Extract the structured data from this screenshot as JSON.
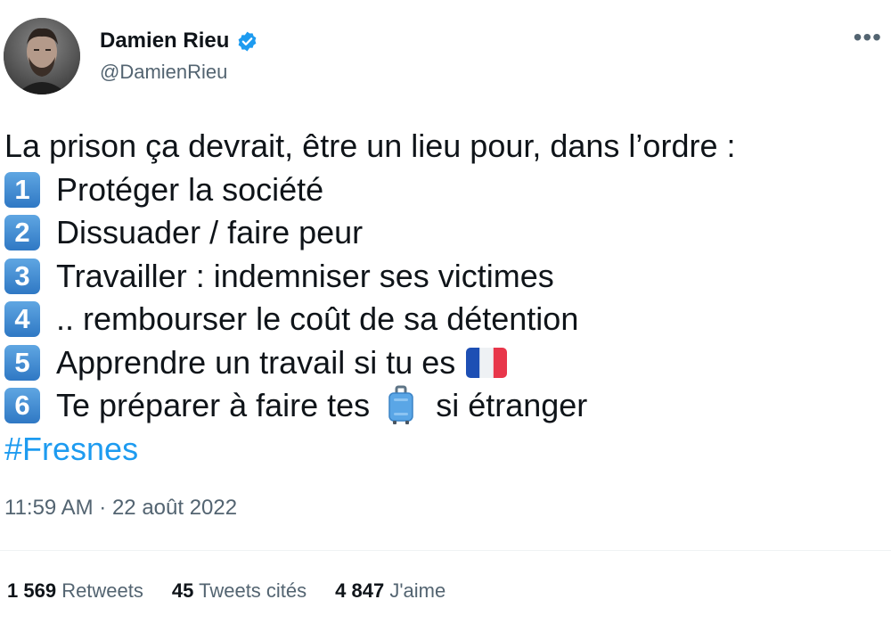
{
  "author": {
    "display_name": "Damien Rieu",
    "handle": "@DamienRieu",
    "verified": true,
    "verified_color": "#1d9bf0"
  },
  "menu_icon": "more-options-icon",
  "tweet": {
    "intro": "La prison ça devrait, être un lieu pour, dans l’ordre :",
    "items": [
      {
        "num": "1",
        "text": "Protéger la société"
      },
      {
        "num": "2",
        "text": "Dissuader / faire peur"
      },
      {
        "num": "3",
        "text": "Travailler : indemniser ses victimes"
      },
      {
        "num": "4",
        "text": ".. rembourser le coût de sa détention"
      },
      {
        "num": "5",
        "text": "Apprendre un travail si tu es",
        "emoji": "french-flag-icon"
      },
      {
        "num": "6",
        "text_before": "Te préparer à faire tes",
        "emoji": "suitcase-icon",
        "text_after": "si étranger"
      }
    ],
    "hashtag": "#Fresnes"
  },
  "timestamp": "11:59 AM · 22 août 2022",
  "stats": {
    "retweets_count": "1 569",
    "retweets_label": "Retweets",
    "quotes_count": "45",
    "quotes_label": "Tweets cités",
    "likes_count": "4 847",
    "likes_label": "J'aime"
  },
  "colors": {
    "accent": "#1d9bf0",
    "secondary_text": "#536471",
    "keycap": "#3a86d1"
  }
}
